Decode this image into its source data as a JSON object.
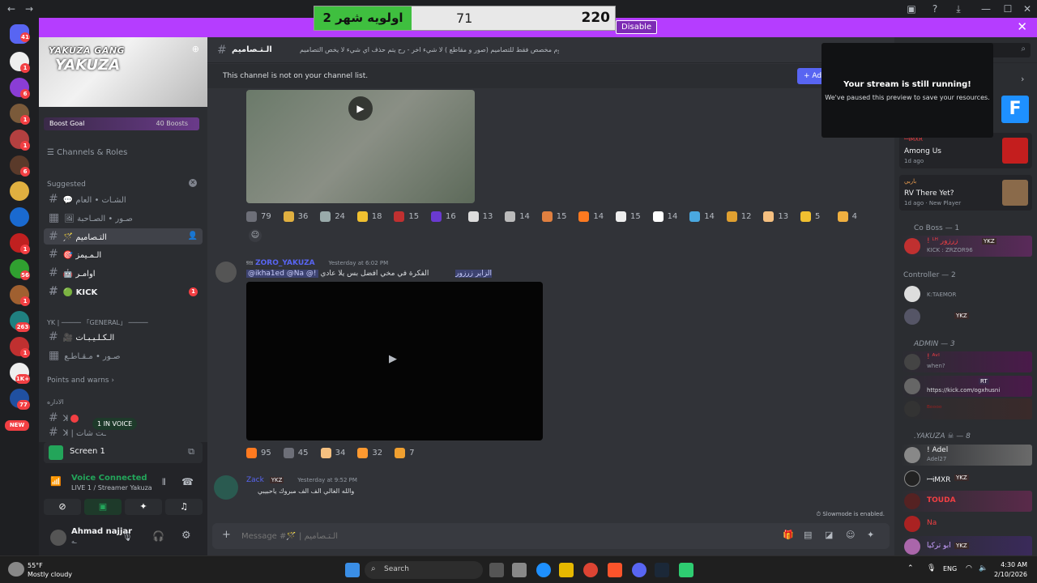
{
  "poll": {
    "label": "اولويه شهر 2",
    "count_mid": "71",
    "count_right": "220"
  },
  "banner": {
    "disable_label": "Disable",
    "close": "✕"
  },
  "rail_badges": [
    "41",
    "1",
    "6",
    "1",
    "1",
    "6",
    "1",
    "1",
    "56",
    "1",
    "1",
    "263",
    "1",
    "1",
    "1K+",
    "77",
    "NEW"
  ],
  "server": {
    "name": "YAKUZA GANG",
    "logo_text": "YAKUZA",
    "boost_label": "Boost Goal",
    "boost_count": "40 Boosts",
    "channels_roles": "Channels & Roles"
  },
  "sidebar": {
    "suggested_label": "Suggested",
    "suggested": [
      {
        "icon": "💬",
        "label": "الشـات • العام"
      },
      {
        "icon": "🖼",
        "label": "صـور • الصـاحبة"
      },
      {
        "icon": "🪄",
        "label": "التـصاميم"
      },
      {
        "icon": "🎯",
        "label": "الـمـيمز"
      },
      {
        "icon": "🤖",
        "label": "اوامـر"
      },
      {
        "icon": "🟢",
        "label": "KICK"
      }
    ],
    "kick_badge": "1",
    "category_general": "YK | ───── 「GENERAL」 ─────",
    "general_channels": [
      {
        "icon": "🎥",
        "label": "الـكـلـيـبـات"
      },
      {
        "icon": "",
        "label": "صـور • مـقـاطـع"
      }
    ],
    "points_label": "Points and warns",
    "category_admin": "الاداره",
    "admin_channels": [
      "ꓘ",
      "ꓘ | ـت شات"
    ],
    "in_voice": "1 IN VOICE"
  },
  "voice_panel": {
    "screen_label": "Screen 1",
    "voice_connected": "Voice Connected",
    "voice_channel": "LIVE 1 / Streamer Yakuza",
    "user_name": "Ahmad najjar",
    "user_status": "ـه"
  },
  "chat": {
    "channel_name": "الـتـصاميم",
    "topic": "هذا الروم مخصص فقط للتصاميم (صور و مقاطع ) لا شيء اخر - رح يتم حذف اي شيء لا يخص التصاميم",
    "notice": "This channel is not on your channel list.",
    "notice_button": "Add",
    "reactions1": [
      {
        "emoji": "grey",
        "count": "79"
      },
      {
        "emoji": "glasses",
        "count": "36"
      },
      {
        "emoji": "knife",
        "count": "24"
      },
      {
        "emoji": "coin",
        "count": "18"
      },
      {
        "emoji": "car",
        "count": "15"
      },
      {
        "emoji": "R",
        "count": "16"
      },
      {
        "emoji": "skull",
        "count": "13"
      },
      {
        "emoji": "skull2",
        "count": "14"
      },
      {
        "emoji": "knife2",
        "count": "15"
      },
      {
        "emoji": "fire",
        "count": "14"
      },
      {
        "emoji": "goat",
        "count": "15"
      },
      {
        "emoji": "mask",
        "count": "14"
      },
      {
        "emoji": "cry",
        "count": "14"
      },
      {
        "emoji": "medal",
        "count": "12"
      },
      {
        "emoji": "hand",
        "count": "13"
      },
      {
        "emoji": "laugh",
        "count": "5"
      },
      {
        "emoji": "salute",
        "count": "4"
      }
    ],
    "msg2_author": "ZORO_YAKUZA",
    "msg2_tag": "𝔑𝔄",
    "msg2_time": "Yesterday at 6:02 PM",
    "msg2_mentions": "@ikha1ed @Na @!",
    "msg2_mention_arabic": "الزاير زرزور",
    "msg2_text": "الفكرة في مخي افضل بس يلا عادي",
    "reactions2": [
      {
        "emoji": "fire",
        "count": "95"
      },
      {
        "emoji": "grey",
        "count": "45"
      },
      {
        "emoji": "hand",
        "count": "34"
      },
      {
        "emoji": "fire2",
        "count": "32"
      },
      {
        "emoji": "heart",
        "count": "7"
      }
    ],
    "msg3_author": "Zack",
    "msg3_role": "YKZ",
    "msg3_time": "Yesterday at 9:52 PM",
    "msg3_text": "والله الغالي الف الف مبروك ياحبيبي",
    "slowmode": "Slowmode is enabled.",
    "input_placeholder": "Message #🪄 | الـتـصاميم"
  },
  "stream_popup": {
    "title": "Your stream is still running!",
    "body": "We've paused this preview to save your resources."
  },
  "members": {
    "activities": [
      {
        "user": "ꟷᎥMXR",
        "game": "Among Us",
        "time": "1d ago"
      },
      {
        "user": "باربي",
        "game": "RV There Yet?",
        "time": "1d ago",
        "extra": "New Player"
      }
    ],
    "sections": [
      {
        "title": "Co Boss — 1",
        "members": [
          {
            "name": "! ᴸᴴ زرزور",
            "tag": "YKZ",
            "sub": "KICK : ZRZOR96"
          }
        ]
      },
      {
        "title": "Controller — 2",
        "members": [
          {
            "name": "",
            "sub": "K:TAEMOR"
          },
          {
            "name": "",
            "tag": "YKZ"
          }
        ]
      },
      {
        "title": "ADMIN — 3",
        "members": [
          {
            "name": "! ᴬᵛᴵ",
            "sub": "when?"
          },
          {
            "name": "",
            "tag": "RT",
            "sub": "https://kick.com/ogxhusni"
          },
          {
            "name": "ᴮᵒᵒᵒᵒ"
          }
        ]
      },
      {
        "title": ".YAKUZA ☠ — 8",
        "members": [
          {
            "name": "! Adel",
            "sub": "Adel27"
          },
          {
            "name": "ꟷᎥMXR",
            "tag": "YKZ"
          },
          {
            "name": "TOUDA"
          },
          {
            "name": "Na"
          },
          {
            "name": "ابو تركيا",
            "tag": "YKZ"
          }
        ]
      }
    ]
  },
  "taskbar": {
    "weather_temp": "55°F",
    "weather_desc": "Mostly cloudy",
    "search": "Search",
    "lang": "ENG",
    "time": "4:30 AM",
    "date": "2/10/2026"
  },
  "colors": {
    "accent": "#5865f2",
    "banner": "#b53dff",
    "poll_green": "#3fbf3f"
  }
}
